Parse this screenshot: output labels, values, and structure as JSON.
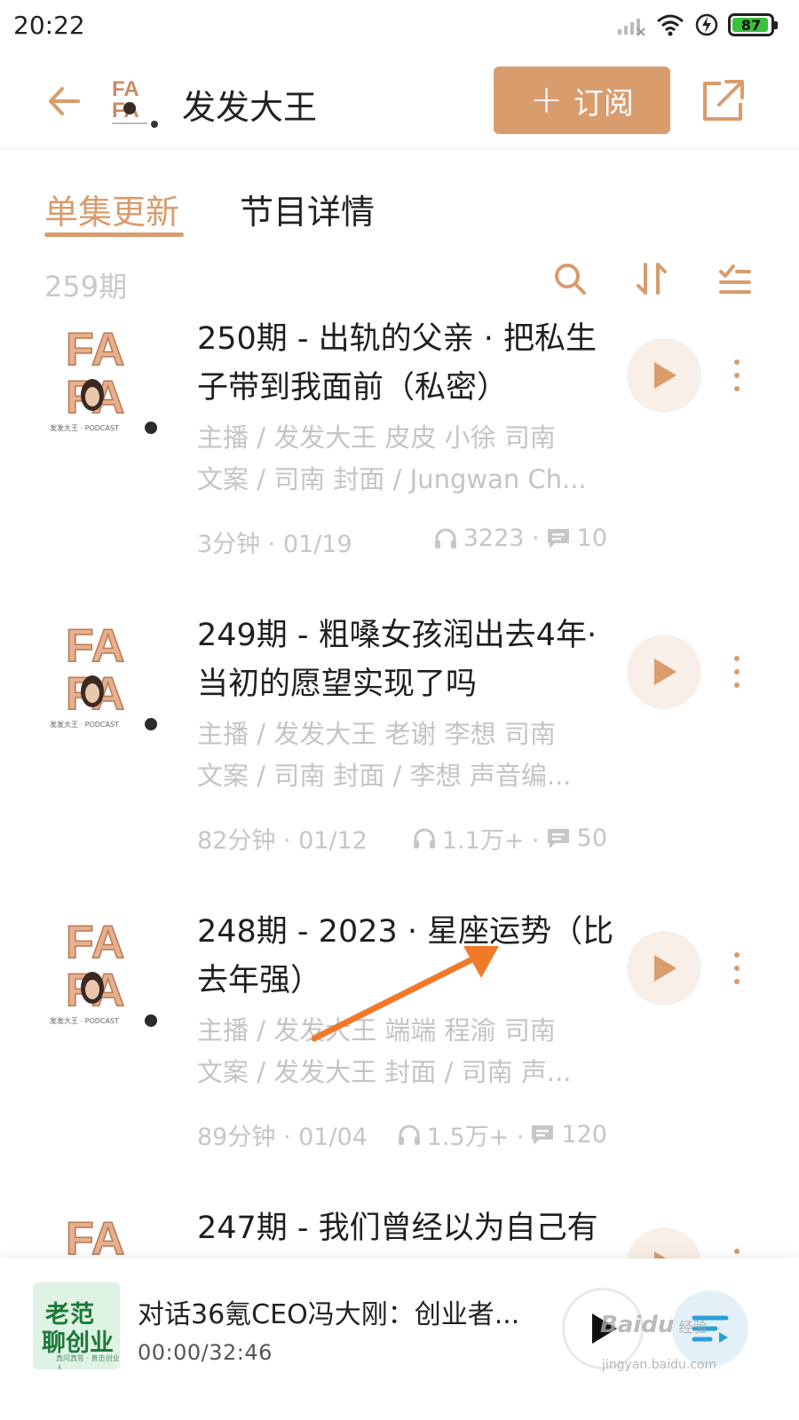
{
  "status_bar": {
    "time": "20:22",
    "battery": "87",
    "battery_fraction": 0.87
  },
  "header": {
    "title": "发发大王",
    "subscribe_label": "订阅",
    "logo_text_1": "FA",
    "logo_text_2": "FA"
  },
  "tabs": [
    {
      "label": "单集更新",
      "active": true
    },
    {
      "label": "节目详情",
      "active": false
    }
  ],
  "toolbar": {
    "episode_count": "259期"
  },
  "episodes": [
    {
      "title": "250期 - 出轨的父亲 · 把私生子带到我面前（私密）",
      "desc_line_1": "主播 / 发发大王 皮皮 小徐 司南",
      "desc_line_2": "文案 / 司南 封面 / Jungwan Ch...",
      "duration_date": "3分钟 · 01/19",
      "plays": "3223 ·",
      "comments": "10",
      "cover_caption": "发发大王 · PODCAST"
    },
    {
      "title": "249期 - 粗嗓女孩润出去4年·当初的愿望实现了吗",
      "desc_line_1": "主播 / 发发大王 老谢 李想 司南",
      "desc_line_2": "文案 / 司南 封面 / 李想 声音编...",
      "duration_date": "82分钟 · 01/12",
      "plays": "1.1万+ ·",
      "comments": "50",
      "cover_caption": "发发大王 · PODCAST"
    },
    {
      "title": "248期 - 2023 · 星座运势（比去年强）",
      "desc_line_1": "主播 / 发发大王 端端 程渝 司南",
      "desc_line_2": "文案 / 发发大王 封面 / 司南 声...",
      "duration_date": "89分钟 · 01/04",
      "plays": "1.5万+ ·",
      "comments": "120",
      "cover_caption": "发发大王 · PODCAST"
    },
    {
      "title": "247期 - 我们曾经以为自己有",
      "cover_caption": "FA"
    }
  ],
  "cover_logo": {
    "line_1": "FA",
    "line_2": "FA"
  },
  "mini_player": {
    "title": "对话36氪CEO冯大刚：创业者...",
    "time": "00:00/32:46",
    "cover_line_1": "老范",
    "cover_line_2": "聊创业",
    "cover_sub": "真问真答 · 直击创业人"
  },
  "watermark": {
    "brand": "Baidu",
    "suffix": "经验",
    "url": "jingyan.baidu.com"
  },
  "colors": {
    "accent": "#d99c6d",
    "annotation_arrow": "#f07a2a"
  },
  "icons": {
    "back": "arrow-left-icon",
    "share": "share-external-icon",
    "search": "search-icon",
    "sort": "sort-icon",
    "filter": "filter-list-icon",
    "play": "play-icon",
    "more": "more-vertical-icon",
    "headphones": "headphones-icon",
    "comment": "comment-icon",
    "playlist": "playlist-icon"
  }
}
